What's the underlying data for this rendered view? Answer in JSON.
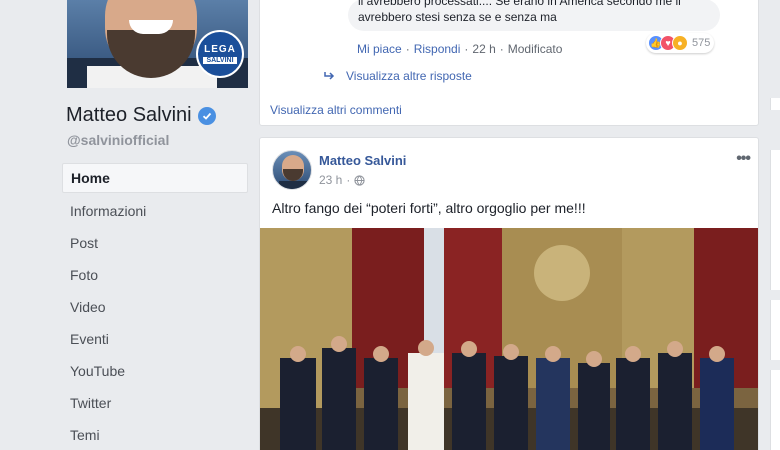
{
  "profile": {
    "name": "Matteo Salvini",
    "handle": "@salviniofficial",
    "badge_line1": "LEGA",
    "badge_line2": "SALVINI"
  },
  "nav": {
    "items": [
      {
        "label": "Home",
        "active": true
      },
      {
        "label": "Informazioni"
      },
      {
        "label": "Post"
      },
      {
        "label": "Foto"
      },
      {
        "label": "Video"
      },
      {
        "label": "Eventi"
      },
      {
        "label": "YouTube"
      },
      {
        "label": "Twitter"
      },
      {
        "label": "Temi"
      }
    ]
  },
  "comment": {
    "text_line1": "li avrebbero processati.... Se erano in America secondo me li",
    "text_line2": "avrebbero stesi senza se e senza ma",
    "like_label": "Mi piace",
    "reply_label": "Rispondi",
    "time": "22 h",
    "edited": "Modificato",
    "reaction_count": "575",
    "more_replies": "Visualizza altre risposte",
    "more_comments": "Visualizza altri commenti"
  },
  "post": {
    "author": "Matteo Salvini",
    "time": "23 h",
    "more_icon": "ellipsis-icon",
    "text": "Altro fango dei “poteri forti”, altro orgoglio per me!!!"
  }
}
